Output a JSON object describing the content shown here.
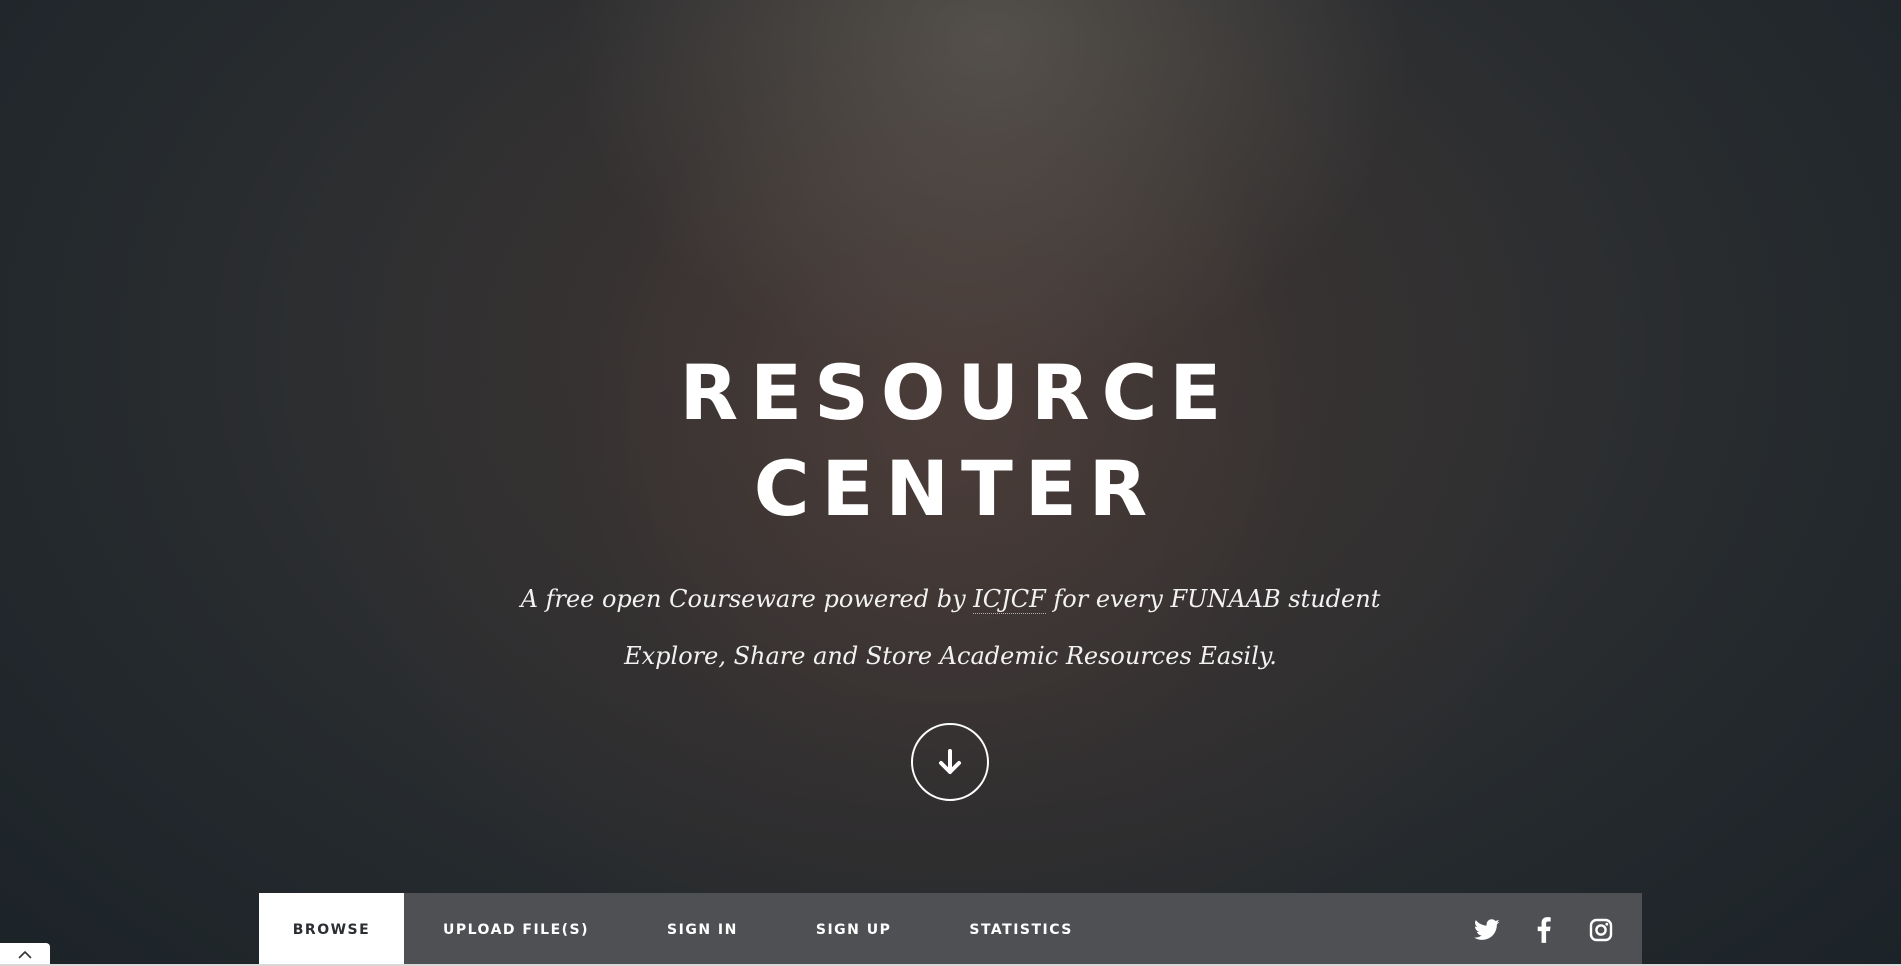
{
  "hero": {
    "title_line1": "RESOURCE",
    "title_line2": "CENTER",
    "subtitle_before": "A free open Courseware powered by ",
    "subtitle_link": "ICJCF",
    "subtitle_after": " for every FUNAAB student",
    "tagline": "Explore, Share and Store Academic Resources Easily.",
    "scroll_icon": "arrow-down-icon"
  },
  "nav": {
    "items": [
      {
        "label": "BROWSE",
        "active": true
      },
      {
        "label": "UPLOAD FILE(S)",
        "active": false
      },
      {
        "label": "SIGN IN",
        "active": false
      },
      {
        "label": "SIGN UP",
        "active": false
      },
      {
        "label": "STATISTICS",
        "active": false
      }
    ],
    "social": [
      "twitter-icon",
      "facebook-icon",
      "instagram-icon"
    ]
  },
  "back_to_top_icon": "chevron-up-icon",
  "colors": {
    "navbar_bg": "#4e5053",
    "active_tab_bg": "#ffffff",
    "text": "#ffffff"
  }
}
